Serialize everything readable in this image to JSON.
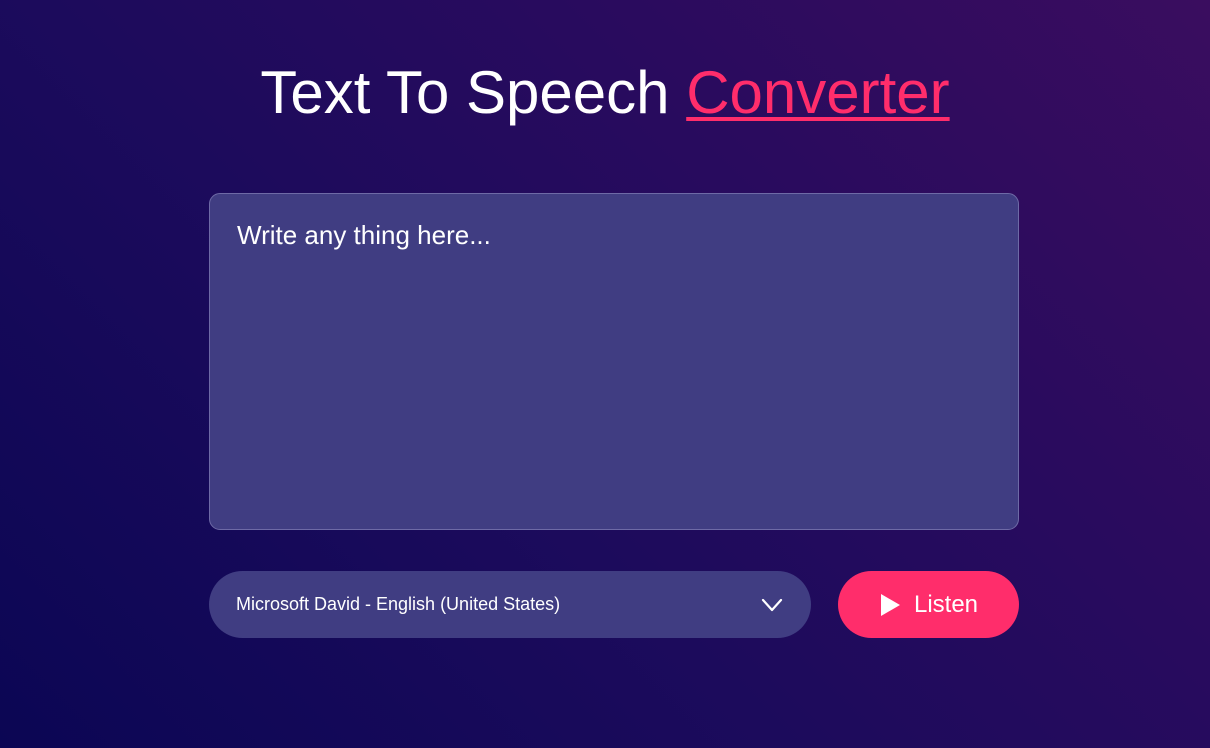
{
  "header": {
    "title_main": "Text To Speech ",
    "title_accent": "Converter"
  },
  "editor": {
    "placeholder": "Write any thing here...",
    "value": ""
  },
  "voice": {
    "selected": "Microsoft David - English (United States)",
    "icon": "chevron-down-icon"
  },
  "actions": {
    "listen_label": "Listen",
    "listen_icon": "play-icon"
  },
  "colors": {
    "background_start": "#0b0654",
    "background_end": "#3a0d5f",
    "accent": "#ff2d6b",
    "panel": "#403d82"
  }
}
